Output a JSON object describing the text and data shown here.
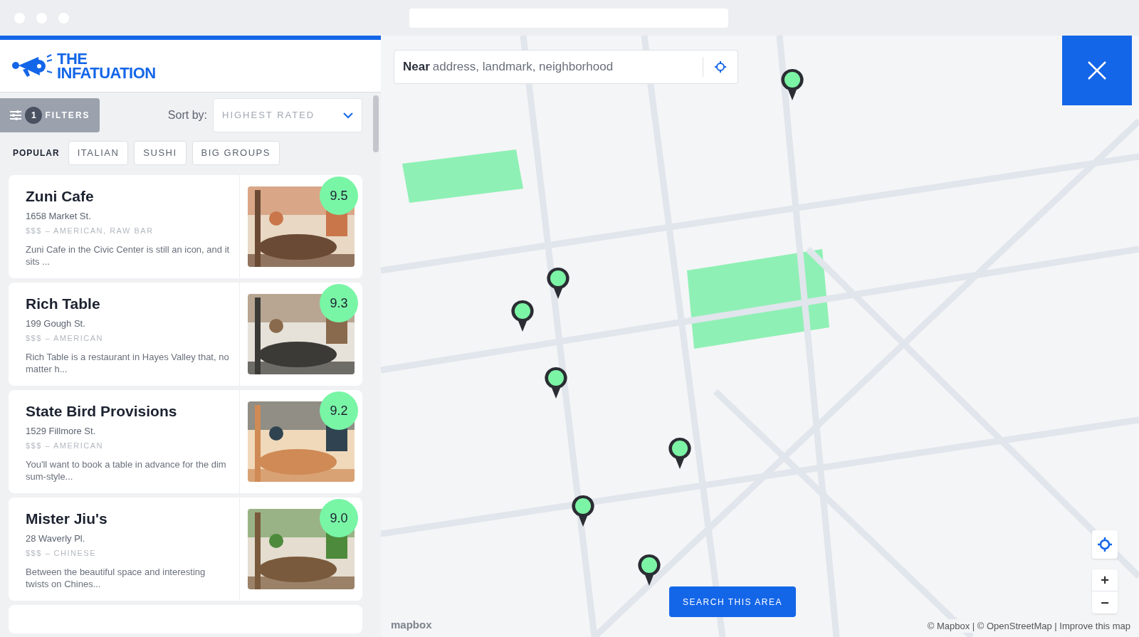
{
  "brand": {
    "line1": "THE",
    "line2": "INFATUATION"
  },
  "filters": {
    "count": "1",
    "label": "FILTERS"
  },
  "sort": {
    "label": "Sort by:",
    "value": "HIGHEST RATED"
  },
  "tabs": [
    {
      "label": "POPULAR",
      "selected": true
    },
    {
      "label": "ITALIAN",
      "selected": false
    },
    {
      "label": "SUSHI",
      "selected": false
    },
    {
      "label": "BIG GROUPS",
      "selected": false
    }
  ],
  "restaurants": [
    {
      "name": "Zuni Cafe",
      "address": "1658 Market St.",
      "meta": "$$$ – AMERICAN, RAW BAR",
      "blurb": "Zuni Cafe in the Civic Center is still an icon, and it sits ...",
      "score": "9.5"
    },
    {
      "name": "Rich Table",
      "address": "199 Gough St.",
      "meta": "$$$ – AMERICAN",
      "blurb": "Rich Table is a restaurant in Hayes Valley that, no matter h...",
      "score": "9.3"
    },
    {
      "name": "State Bird Provisions",
      "address": "1529 Fillmore St.",
      "meta": "$$$ – AMERICAN",
      "blurb": "You'll want to book a table in advance for the dim sum-style...",
      "score": "9.2"
    },
    {
      "name": "Mister Jiu's",
      "address": "28 Waverly Pl.",
      "meta": "$$$ – CHINESE",
      "blurb": "Between the beautiful space and interesting twists on Chines...",
      "score": "9.0"
    }
  ],
  "map": {
    "search": {
      "prefix": "Near",
      "placeholder": "address, landmark, neighborhood"
    },
    "search_area_button": "SEARCH THIS AREA",
    "zoom_in": "+",
    "zoom_out": "−",
    "logo": "mapbox",
    "attribution": "© Mapbox | © OpenStreetMap | Improve this map"
  }
}
